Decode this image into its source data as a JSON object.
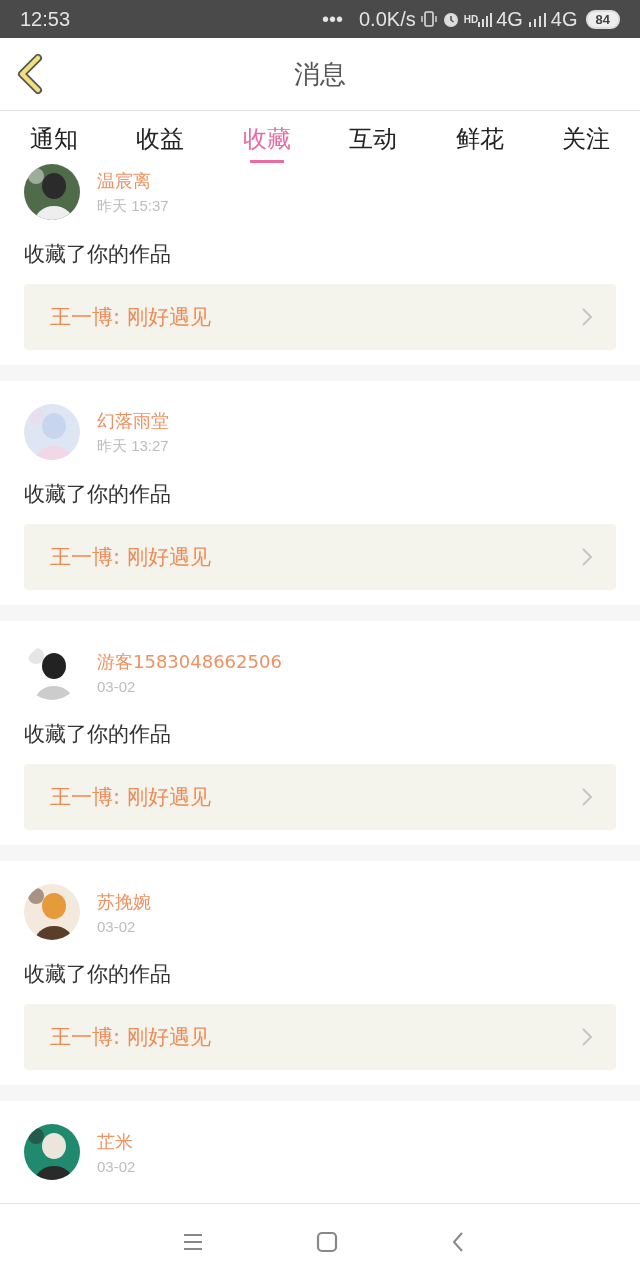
{
  "status_bar": {
    "time": "12:53",
    "dots": "•••",
    "speed": "0.0K/s",
    "hd": "HD",
    "network_1": "4G",
    "network_2": "4G",
    "battery": "84"
  },
  "header": {
    "title": "消息"
  },
  "tabs": [
    {
      "label": "通知",
      "selected": false
    },
    {
      "label": "收益",
      "selected": false
    },
    {
      "label": "收藏",
      "selected": true
    },
    {
      "label": "互动",
      "selected": false
    },
    {
      "label": "鲜花",
      "selected": false
    },
    {
      "label": "关注",
      "selected": false
    }
  ],
  "messages": [
    {
      "name": "温宸离",
      "time": "昨天 15:37",
      "action": "收藏了你的作品",
      "work": "王一博: 刚好遇见"
    },
    {
      "name": "幻落雨堂",
      "time": "昨天 13:27",
      "action": "收藏了你的作品",
      "work": "王一博: 刚好遇见"
    },
    {
      "name": "游客1583048662506",
      "time": "03-02",
      "action": "收藏了你的作品",
      "work": "王一博: 刚好遇见"
    },
    {
      "name": "苏挽婉",
      "time": "03-02",
      "action": "收藏了你的作品",
      "work": "王一博: 刚好遇见"
    },
    {
      "name": "芷米",
      "time": "03-02"
    }
  ]
}
